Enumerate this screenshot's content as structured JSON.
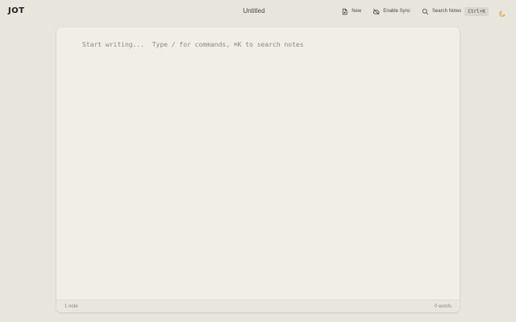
{
  "app": {
    "logo": "JOT"
  },
  "document": {
    "title": "Untitled"
  },
  "toolbar": {
    "new_label": "New",
    "sync_label": "Enable Sync",
    "search_label": "Search Notes",
    "search_shortcut": "Ctrl+K"
  },
  "editor": {
    "placeholder": "Start writing...  Type / for commands, ⌘K to search notes"
  },
  "status": {
    "note_count": "1 note",
    "word_count": "0 words"
  },
  "icons": {
    "new": "file-plus-icon",
    "sync": "cloud-off-icon",
    "search": "search-icon",
    "theme": "moon-icon"
  },
  "colors": {
    "background": "#e8e5dd",
    "card": "#f1eee7",
    "theme_icon": "#e0a030"
  }
}
